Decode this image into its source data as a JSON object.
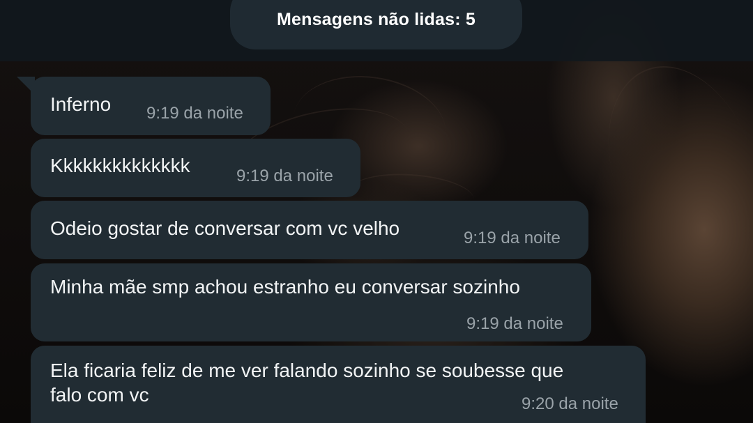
{
  "header": {
    "unread_label": "Mensagens não lidas: 5"
  },
  "messages": [
    {
      "text_lines": [
        "Inferno"
      ],
      "time": "9:19 da noite"
    },
    {
      "text_lines": [
        "Kkkkkkkkkkkkkk"
      ],
      "time": "9:19 da noite"
    },
    {
      "text_lines": [
        "Odeio gostar de conversar com vc velho"
      ],
      "time": "9:19 da noite"
    },
    {
      "text_lines": [
        "Minha mãe smp achou estranho eu conversar sozinho"
      ],
      "time": "9:19 da noite"
    },
    {
      "text_lines": [
        "Ela ficaria feliz de me ver falando sozinho se soubesse que",
        "falo com vc"
      ],
      "time": "9:20 da noite"
    }
  ],
  "colors": {
    "bubble": "#212c33",
    "topbar": "#11181d",
    "pill": "#1f2a32",
    "time_text": "#9aa3a9"
  }
}
